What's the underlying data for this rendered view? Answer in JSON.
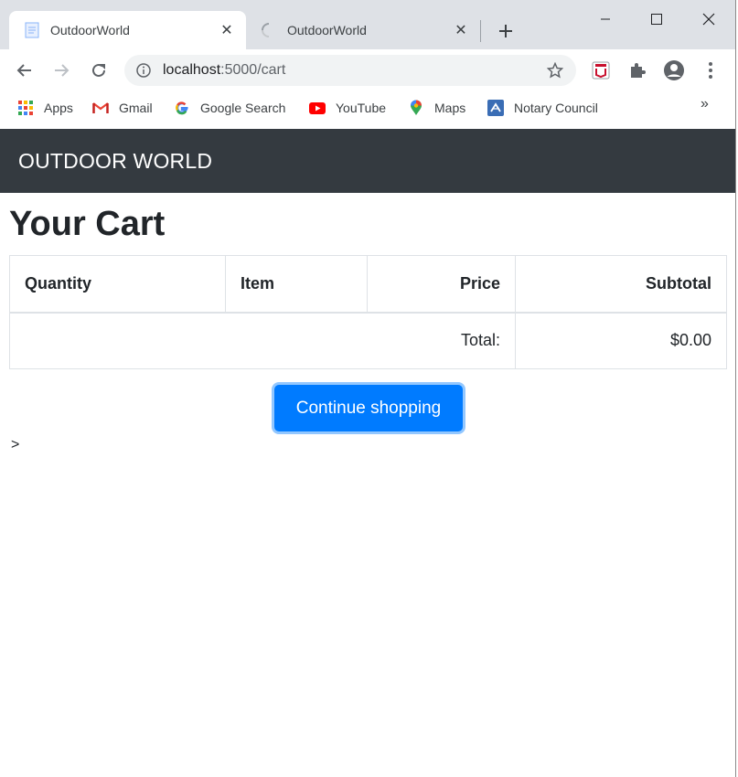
{
  "browser": {
    "tabs": [
      {
        "title": "OutdoorWorld",
        "active": true
      },
      {
        "title": "OutdoorWorld",
        "active": false
      }
    ],
    "address": {
      "host": "localhost",
      "path": ":5000/cart"
    },
    "bookmarks": [
      {
        "label": "Apps",
        "icon": "apps-grid-icon"
      },
      {
        "label": "Gmail",
        "icon": "gmail-icon"
      },
      {
        "label": "Google Search",
        "icon": "google-icon"
      },
      {
        "label": "YouTube",
        "icon": "youtube-icon"
      },
      {
        "label": "Maps",
        "icon": "maps-pin-icon"
      },
      {
        "label": "Notary Council",
        "icon": "notary-icon"
      }
    ],
    "more_bookmarks": "»"
  },
  "navbar": {
    "brand": "OUTDOOR WORLD"
  },
  "cart": {
    "title": "Your Cart",
    "headers": {
      "quantity": "Quantity",
      "item": "Item",
      "price": "Price",
      "subtotal": "Subtotal"
    },
    "total_label": "Total:",
    "total_value": "$0.00",
    "continue_label": "Continue shopping"
  },
  "stray_text": ">",
  "colors": {
    "navbar_bg": "#343a40",
    "primary": "#007bff",
    "tabstrip_bg": "#dee1e6"
  }
}
